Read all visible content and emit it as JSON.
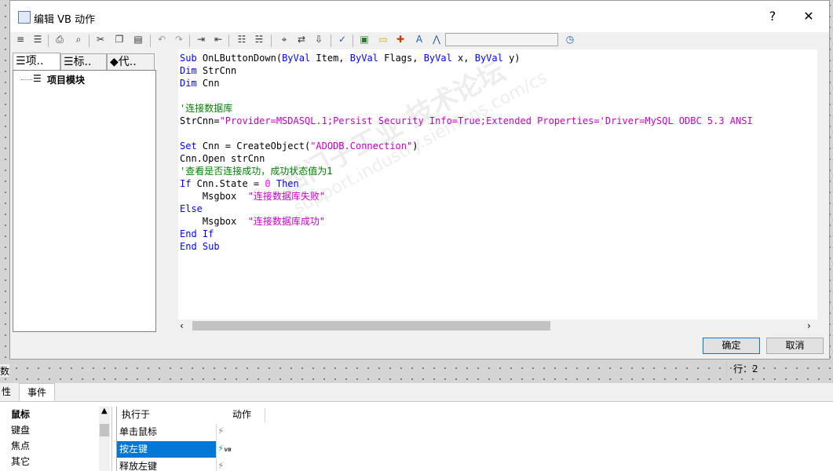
{
  "dialog": {
    "title": "编辑 VB 动作",
    "help": "?",
    "close": "✕"
  },
  "toolbar": {
    "combo_value": ""
  },
  "tabs": [
    {
      "label": "项.."
    },
    {
      "label": "标.."
    },
    {
      "label": "代.."
    }
  ],
  "tree": {
    "root_label": "项目模块"
  },
  "code": {
    "lines": [
      "Sub OnLButtonDown(ByVal Item, ByVal Flags, ByVal x, ByVal y)",
      "Dim StrCnn",
      "Dim Cnn",
      "",
      "'连接数据库",
      "StrCnn=\"Provider=MSDASQL.1;Persist Security Info=True;Extended Properties='Driver=MySQL ODBC 5.3 ANSI",
      "",
      "Set Cnn = CreateObject(\"ADODB.Connection\")",
      "Cnn.Open strCnn",
      "'查看是否连接成功，成功状态值为1",
      "If Cnn.State = 0 Then",
      "    Msgbox  \"连接数据库失败\"",
      "Else",
      "    Msgbox  \"连接数据库成功\"",
      "End If",
      "End Sub"
    ]
  },
  "watermark": {
    "line1": "西门子工业 技术论坛",
    "line2": "support.industry.siemens.com/cs"
  },
  "buttons": {
    "ok": "确定",
    "cancel": "取消"
  },
  "status": {
    "row_label": "行：",
    "row_value": "2"
  },
  "background": {
    "left_cut_label": "数据"
  },
  "bottom_panel": {
    "tabs": [
      {
        "label": "性"
      },
      {
        "label": "事件"
      }
    ],
    "event_tree": [
      {
        "label": "鼠标",
        "bold": true
      },
      {
        "label": "键盘"
      },
      {
        "label": "焦点"
      },
      {
        "label": "其它"
      }
    ],
    "grid_headers": [
      "执行于",
      "动作"
    ],
    "grid_rows": [
      {
        "label": "单击鼠标",
        "action_icon": "lightning-icon",
        "selected": false
      },
      {
        "label": "按左键",
        "action_icon": "lightning-vb-icon",
        "selected": true
      },
      {
        "label": "释放左键",
        "action_icon": "lightning-icon",
        "selected": false
      }
    ]
  }
}
